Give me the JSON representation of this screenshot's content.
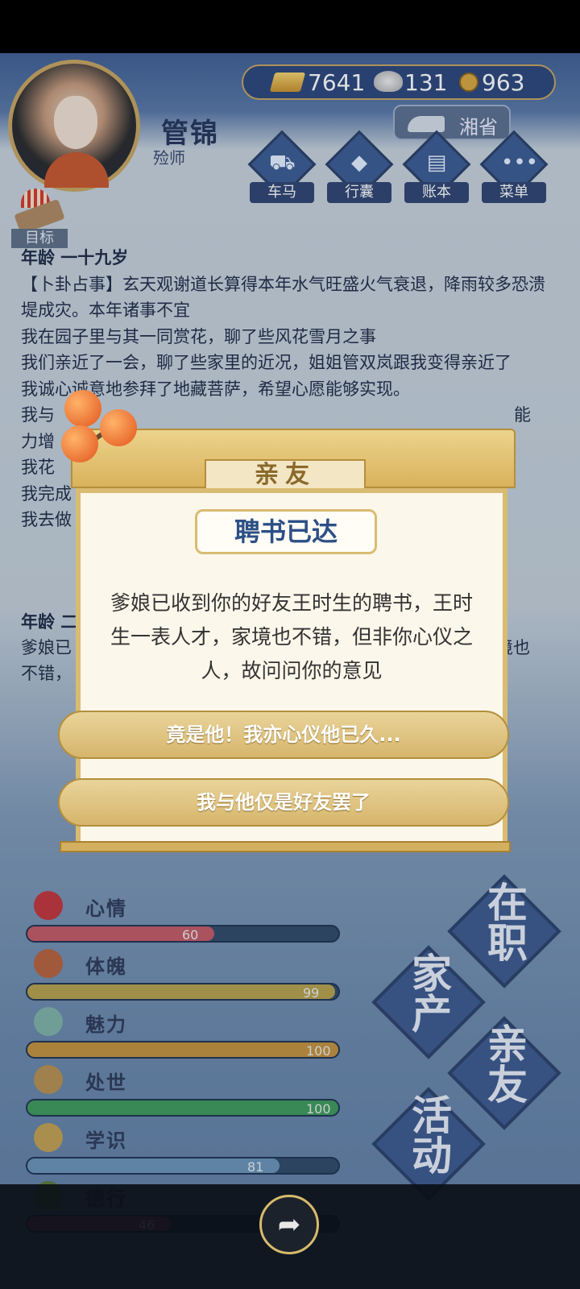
{
  "header": {
    "name": "管锦",
    "title": "殓师",
    "currency": {
      "gold": "7641",
      "silver": "131",
      "coins": "963"
    },
    "province": "湘省"
  },
  "nav": [
    "车马",
    "行囊",
    "账本",
    "菜单"
  ],
  "goal_label": "目标",
  "log": {
    "age_heading": "年龄 一十九岁",
    "lines": [
      "【卜卦占事】玄天观谢道长算得本年水气旺盛火气衰退，降雨较多恐溃堤成灾。本年诸事不宜",
      "我在园子里与其一同赏花，聊了些风花雪月之事",
      "我们亲近了一会，聊了些家里的近况，姐姐管双岚跟我变得亲近了",
      "我诚心诚意地参拜了地藏菩萨，希望心愿能够实现。",
      "我与",
      "力增",
      "我花",
      "我完成",
      "我去做"
    ],
    "line5_tail": "能",
    "age_heading2": "年龄 二",
    "line_b1": "爹娘已",
    "line_b1_tail": "境也",
    "line_b2": "不错，"
  },
  "dialog": {
    "tab_label": "亲友",
    "title": "聘书已达",
    "message": "爹娘已收到你的好友王时生的聘书，王时生一表人才，家境也不错，但非你心仪之人，故问问你的意见",
    "choice_accept": "竟是他！我亦心仪他已久...",
    "choice_decline": "我与他仅是好友罢了"
  },
  "stats": [
    {
      "name": "心情",
      "value": 60,
      "color": "#c45a64"
    },
    {
      "name": "体魄",
      "value": 99,
      "color": "#b7a24a"
    },
    {
      "name": "魅力",
      "value": 100,
      "color": "#c4923c"
    },
    {
      "name": "处世",
      "value": 100,
      "color": "#3e9a5a"
    },
    {
      "name": "学识",
      "value": 81,
      "color": "#6a93b8"
    },
    {
      "name": "德行",
      "value": 46,
      "color": "#b04a7a"
    }
  ],
  "big_buttons": [
    "在职",
    "家产",
    "亲友",
    "活动"
  ]
}
